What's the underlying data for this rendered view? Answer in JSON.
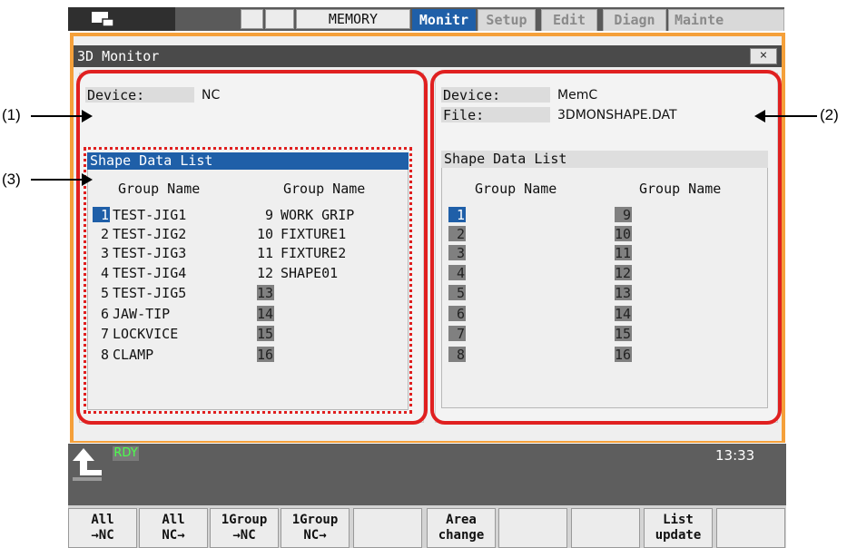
{
  "top_bar": {
    "mode_label": "MEMORY",
    "tabs": [
      "Monitr",
      "Setup",
      "Edit",
      "Diagn",
      "Mainte"
    ],
    "active_tab": "Monitr"
  },
  "window": {
    "title": "3D Monitor",
    "close_label": "×"
  },
  "annotations": {
    "label_1": "(1)",
    "label_2": "(2)",
    "label_3": "(3)"
  },
  "left_panel": {
    "device_label": "Device:",
    "device_value": "NC",
    "list_title": "Shape Data List",
    "col1_header": "Group Name",
    "col2_header": "Group Name",
    "col1": [
      {
        "no": "1",
        "name": "TEST-JIG1"
      },
      {
        "no": "2",
        "name": "TEST-JIG2"
      },
      {
        "no": "3",
        "name": "TEST-JIG3"
      },
      {
        "no": "4",
        "name": "TEST-JIG4"
      },
      {
        "no": "5",
        "name": "TEST-JIG5"
      },
      {
        "no": "6",
        "name": "JAW-TIP"
      },
      {
        "no": "7",
        "name": "LOCKVICE"
      },
      {
        "no": "8",
        "name": "CLAMP"
      }
    ],
    "col2": [
      {
        "no": "9",
        "name": "WORK GRIP"
      },
      {
        "no": "10",
        "name": "FIXTURE1"
      },
      {
        "no": "11",
        "name": "FIXTURE2"
      },
      {
        "no": "12",
        "name": "SHAPE01"
      },
      {
        "no": "13",
        "name": ""
      },
      {
        "no": "14",
        "name": ""
      },
      {
        "no": "15",
        "name": ""
      },
      {
        "no": "16",
        "name": ""
      }
    ]
  },
  "right_panel": {
    "device_label": "Device:",
    "device_value": "MemC",
    "file_label": "File:",
    "file_value": "3DMONSHAPE.DAT",
    "list_title": "Shape Data List",
    "col1_header": "Group Name",
    "col2_header": "Group Name",
    "col1": [
      "1",
      "2",
      "3",
      "4",
      "5",
      "6",
      "7",
      "8"
    ],
    "col2": [
      "9",
      "10",
      "11",
      "12",
      "13",
      "14",
      "15",
      "16"
    ]
  },
  "status": {
    "ready": "RDY",
    "time": "13:33"
  },
  "menu": [
    {
      "line1": "All",
      "line2": "→NC"
    },
    {
      "line1": "All",
      "line2": "NC→"
    },
    {
      "line1": "1Group",
      "line2": "→NC"
    },
    {
      "line1": "1Group",
      "line2": "NC→"
    },
    {
      "line1": "",
      "line2": ""
    },
    {
      "line1": "Area",
      "line2": "change"
    },
    {
      "line1": "",
      "line2": ""
    },
    {
      "line1": "",
      "line2": ""
    },
    {
      "line1": "List",
      "line2": "update"
    },
    {
      "line1": "",
      "line2": ""
    }
  ],
  "colors": {
    "accent_blue": "#1f5fa8",
    "frame_orange": "#f5a03a",
    "annotation_red": "#e02020",
    "ready_green": "#4cff4c"
  }
}
